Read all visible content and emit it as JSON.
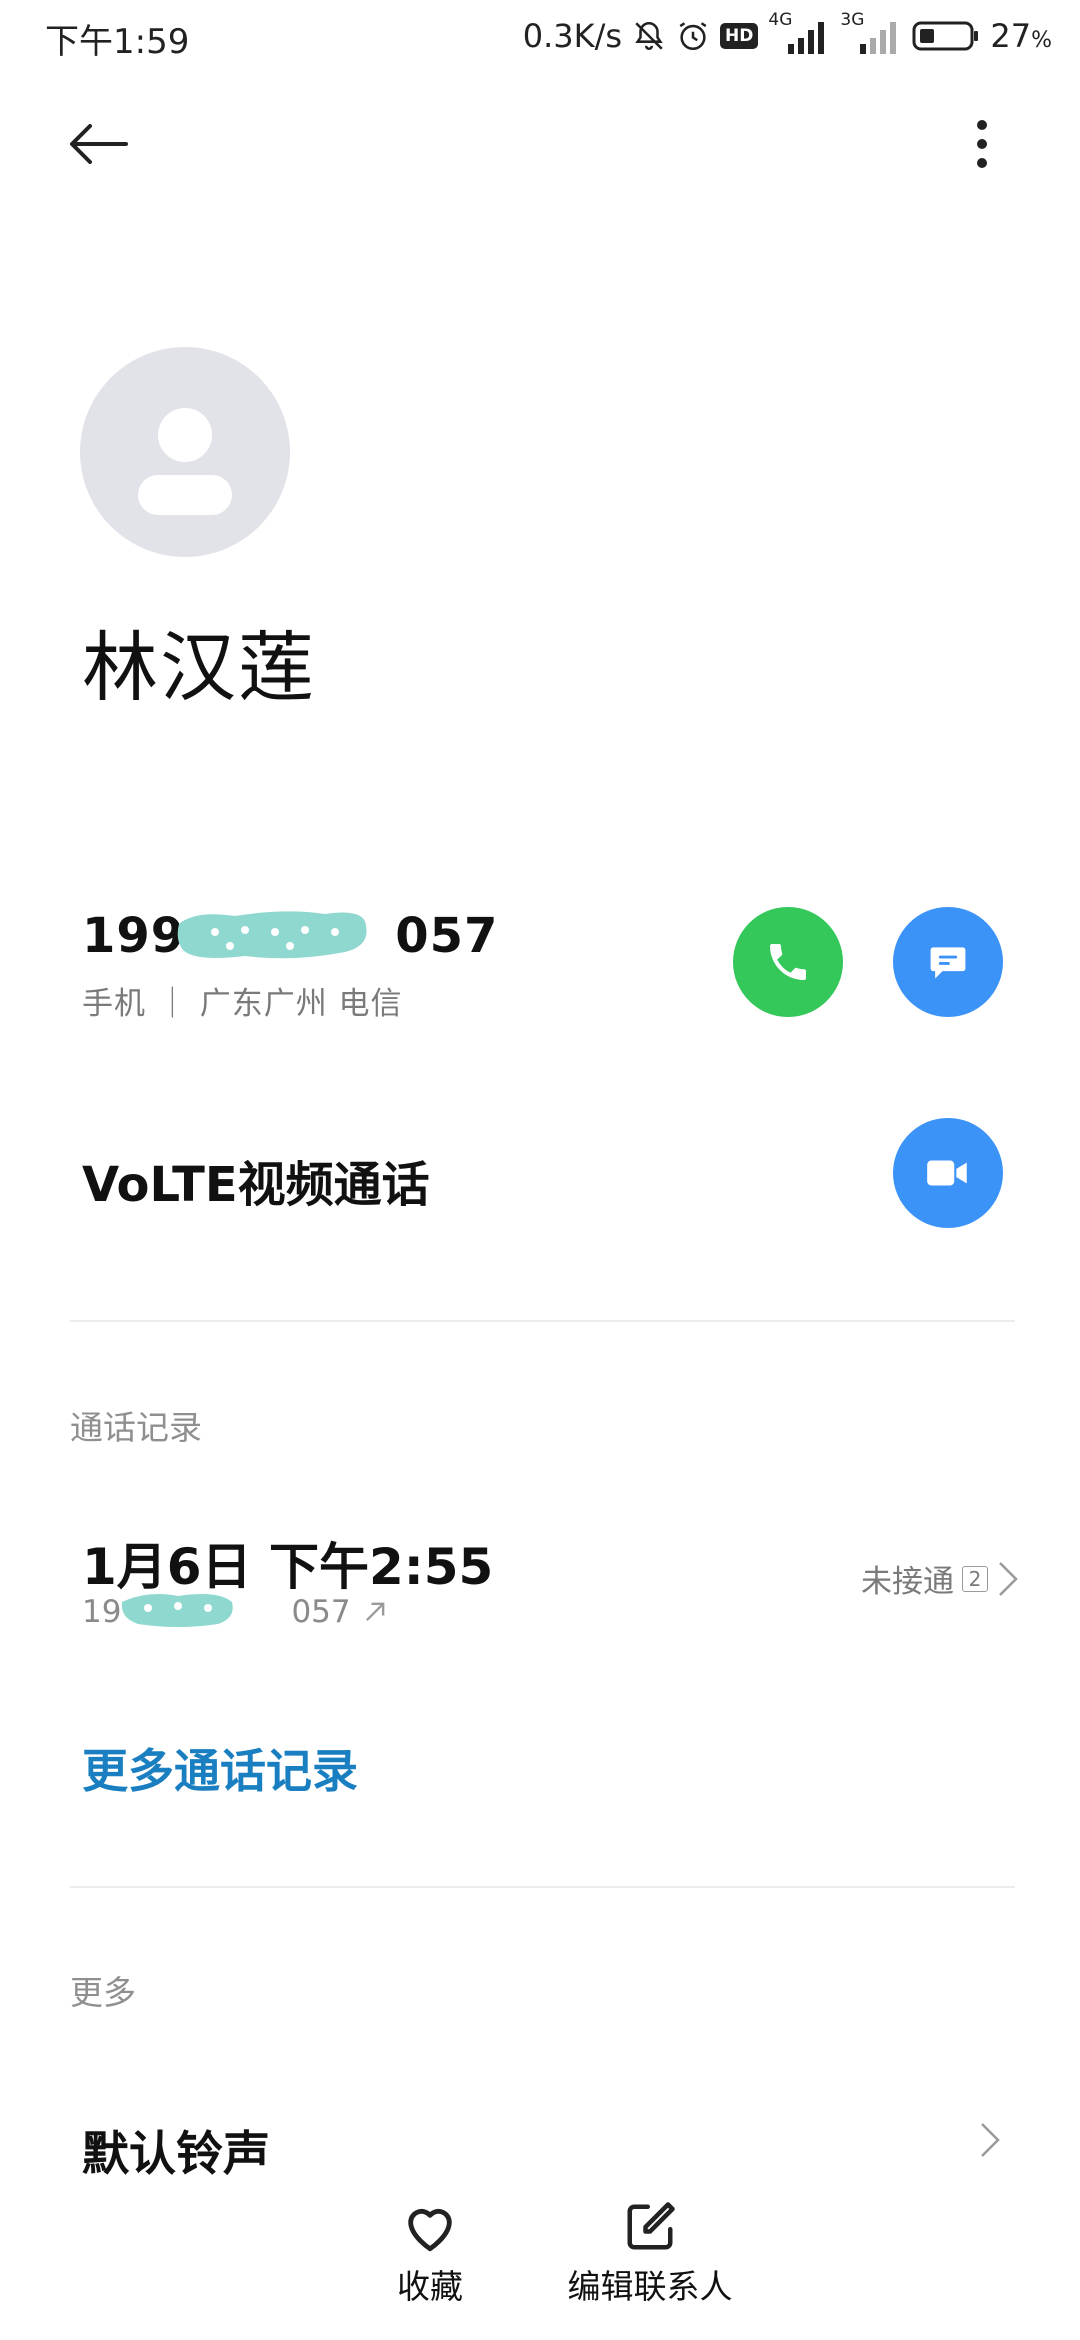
{
  "status_bar": {
    "time": "下午1:59",
    "net_speed": "0.3K/s",
    "hd": "HD",
    "signal1_label": "4G",
    "signal2_label": "3G",
    "battery": "27",
    "battery_unit": "%"
  },
  "header": {
    "back_icon": "back-arrow-icon",
    "more_icon": "more-vertical-icon"
  },
  "contact": {
    "name": "林汉莲",
    "phone_prefix": "199",
    "phone_suffix": "057",
    "phone_info": "手机 ｜ 广东广州 电信",
    "volte_label": "VoLTE视频通话"
  },
  "call_log": {
    "section_title": "通话记录",
    "entries": [
      {
        "date": "1月6日  下午2:55",
        "number_prefix": "19",
        "number_suffix": "057",
        "status": "未接通",
        "count": "2"
      }
    ],
    "more_link": "更多通话记录"
  },
  "more": {
    "section_title": "更多",
    "ringtone_label": "默认铃声"
  },
  "bottom_bar": {
    "favorite_label": "收藏",
    "edit_label": "编辑联系人"
  },
  "colors": {
    "call_green": "#34c759",
    "action_blue": "#3b93f7",
    "link_blue": "#1a7fc0",
    "mask_teal": "#8fd8cf"
  }
}
